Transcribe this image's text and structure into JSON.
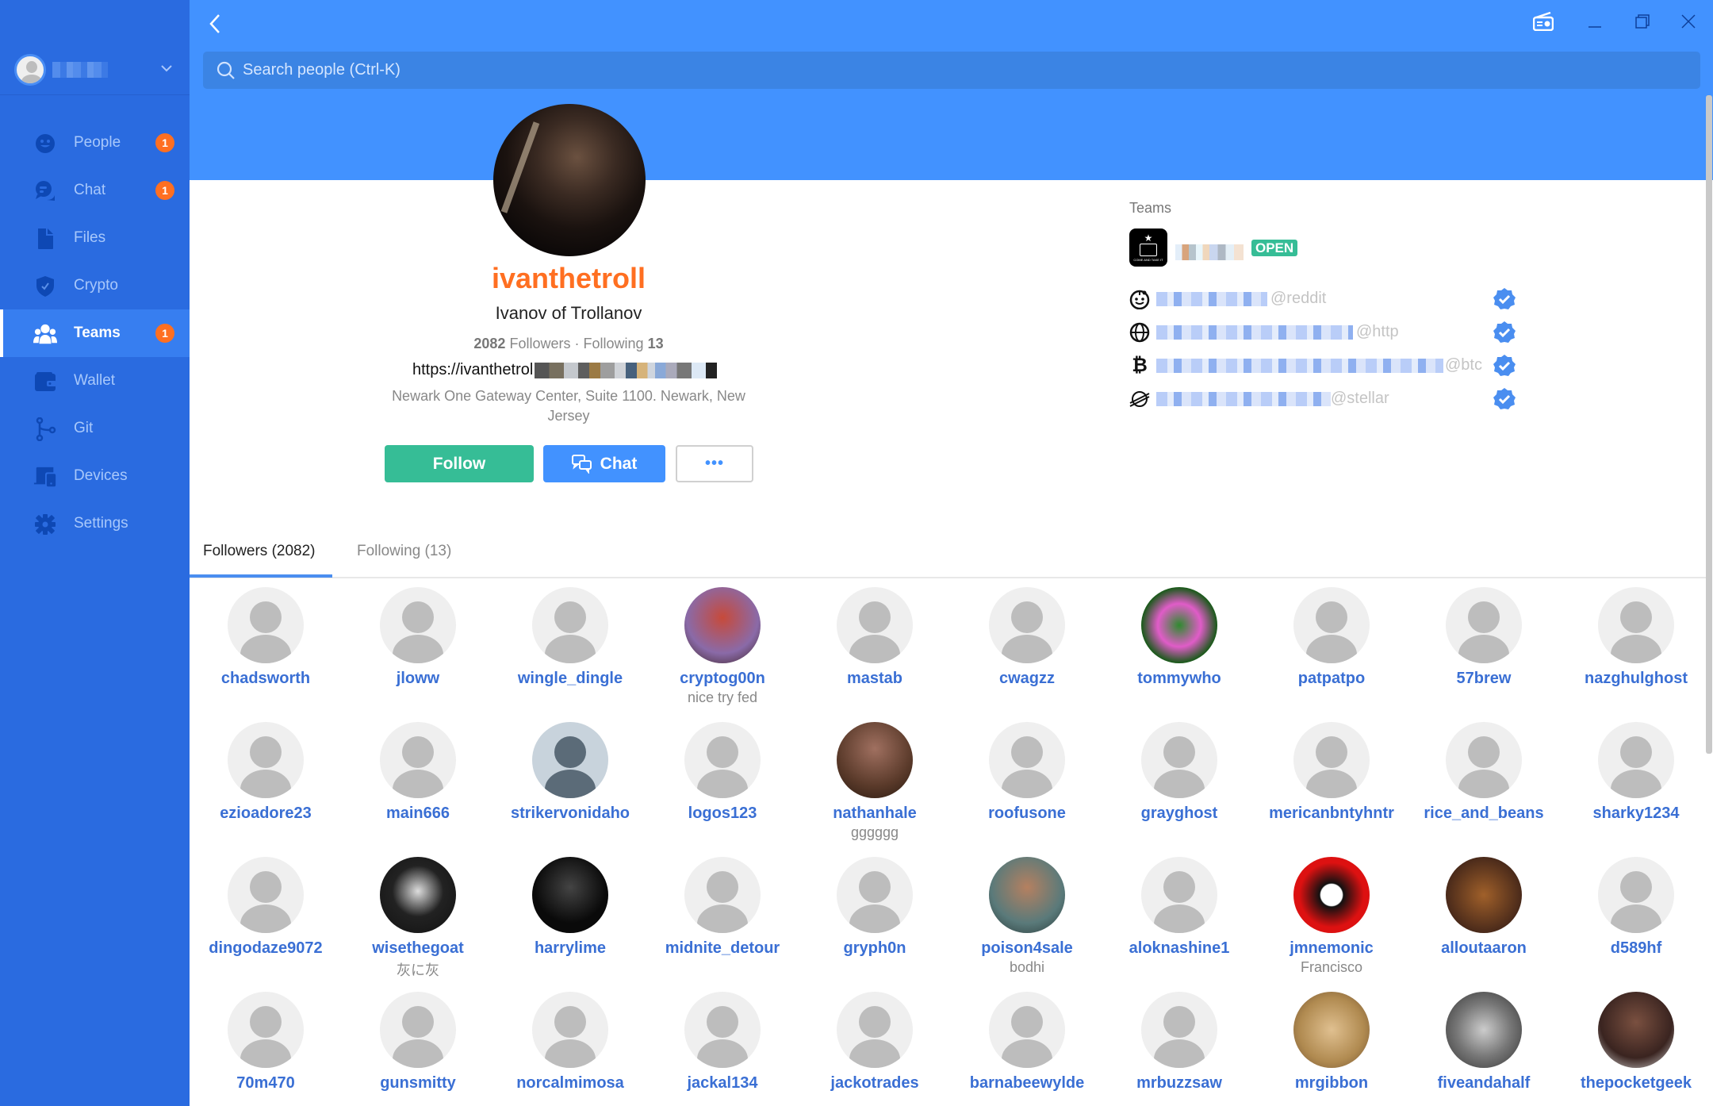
{
  "sidebar": {
    "account": {
      "username_redacted": true
    },
    "items": [
      {
        "label": "People",
        "icon": "smile-icon",
        "badge": "1",
        "active": false
      },
      {
        "label": "Chat",
        "icon": "chat-bubbles-icon",
        "badge": "1",
        "active": false
      },
      {
        "label": "Files",
        "icon": "file-icon",
        "badge": null,
        "active": false
      },
      {
        "label": "Crypto",
        "icon": "shield-check-icon",
        "badge": null,
        "active": false
      },
      {
        "label": "Teams",
        "icon": "people-group-icon",
        "badge": "1",
        "active": true
      },
      {
        "label": "Wallet",
        "icon": "wallet-icon",
        "badge": null,
        "active": false
      },
      {
        "label": "Git",
        "icon": "git-branch-icon",
        "badge": null,
        "active": false
      },
      {
        "label": "Devices",
        "icon": "devices-icon",
        "badge": null,
        "active": false
      },
      {
        "label": "Settings",
        "icon": "gear-icon",
        "badge": null,
        "active": false
      }
    ]
  },
  "header": {
    "search_placeholder": "Search people (Ctrl-K)",
    "window_controls": [
      "radio-icon",
      "minimize-icon",
      "restore-icon",
      "close-icon"
    ]
  },
  "profile": {
    "username": "ivanthetroll",
    "full_name": "Ivanov of Trollanov",
    "followers_count": "2082",
    "followers_label": "Followers",
    "separator": "·",
    "following_label": "Following",
    "following_count": "13",
    "url_prefix": "https://ivanthetrol",
    "location": "Newark One Gateway Center, Suite 1100. Newark, New Jersey",
    "buttons": {
      "follow": "Follow",
      "chat": "Chat",
      "more": "•••"
    }
  },
  "teams_panel": {
    "title": "Teams",
    "team": {
      "logo_text": "COME AND TAKE IT",
      "status_badge": "OPEN"
    },
    "proofs": [
      {
        "icon": "reddit-icon",
        "service": "@reddit",
        "verified": true
      },
      {
        "icon": "globe-icon",
        "service": "@http",
        "verified": true
      },
      {
        "icon": "bitcoin-icon",
        "service": "@btc",
        "verified": true
      },
      {
        "icon": "stellar-icon",
        "service": "@stellar",
        "verified": true
      }
    ]
  },
  "tabs": [
    {
      "label": "Followers (2082)",
      "active": true
    },
    {
      "label": "Following (13)",
      "active": false
    }
  ],
  "followers": [
    {
      "name": "chadsworth",
      "sub": "",
      "avatar": "default"
    },
    {
      "name": "jloww",
      "sub": "",
      "avatar": "default"
    },
    {
      "name": "wingle_dingle",
      "sub": "",
      "avatar": "default"
    },
    {
      "name": "cryptog00n",
      "sub": "nice try fed",
      "avatar": "photo"
    },
    {
      "name": "mastab",
      "sub": "",
      "avatar": "default"
    },
    {
      "name": "cwagzz",
      "sub": "",
      "avatar": "default"
    },
    {
      "name": "tommywho",
      "sub": "",
      "avatar": "photo"
    },
    {
      "name": "patpatpo",
      "sub": "",
      "avatar": "default"
    },
    {
      "name": "57brew",
      "sub": "",
      "avatar": "default"
    },
    {
      "name": "nazghulghost",
      "sub": "",
      "avatar": "default"
    },
    {
      "name": "ezioadore23",
      "sub": "",
      "avatar": "default"
    },
    {
      "name": "main666",
      "sub": "",
      "avatar": "default"
    },
    {
      "name": "strikervonidaho",
      "sub": "",
      "avatar": "dark-default"
    },
    {
      "name": "logos123",
      "sub": "",
      "avatar": "default"
    },
    {
      "name": "nathanhale",
      "sub": "gggggg",
      "avatar": "photo"
    },
    {
      "name": "roofusone",
      "sub": "",
      "avatar": "default"
    },
    {
      "name": "grayghost",
      "sub": "",
      "avatar": "default"
    },
    {
      "name": "mericanbntyhntr",
      "sub": "",
      "avatar": "default"
    },
    {
      "name": "rice_and_beans",
      "sub": "",
      "avatar": "default"
    },
    {
      "name": "sharky1234",
      "sub": "",
      "avatar": "default"
    },
    {
      "name": "dingodaze9072",
      "sub": "",
      "avatar": "default"
    },
    {
      "name": "wisethegoat",
      "sub": "灰に灰",
      "avatar": "photo"
    },
    {
      "name": "harrylime",
      "sub": "",
      "avatar": "photo"
    },
    {
      "name": "midnite_detour",
      "sub": "",
      "avatar": "default"
    },
    {
      "name": "gryph0n",
      "sub": "",
      "avatar": "default"
    },
    {
      "name": "poison4sale",
      "sub": "bodhi",
      "avatar": "photo"
    },
    {
      "name": "aloknashine1",
      "sub": "",
      "avatar": "default"
    },
    {
      "name": "jmnemonic",
      "sub": "Francisco",
      "avatar": "photo"
    },
    {
      "name": "alloutaaron",
      "sub": "",
      "avatar": "photo"
    },
    {
      "name": "d589hf",
      "sub": "",
      "avatar": "default"
    },
    {
      "name": "70m470",
      "sub": "",
      "avatar": "default"
    },
    {
      "name": "gunsmitty",
      "sub": "",
      "avatar": "default"
    },
    {
      "name": "norcalmimosa",
      "sub": "",
      "avatar": "default"
    },
    {
      "name": "jackal134",
      "sub": "",
      "avatar": "default"
    },
    {
      "name": "jackotrades",
      "sub": "",
      "avatar": "default"
    },
    {
      "name": "barnabeewylde",
      "sub": "",
      "avatar": "default"
    },
    {
      "name": "mrbuzzsaw",
      "sub": "",
      "avatar": "default"
    },
    {
      "name": "mrgibbon",
      "sub": "",
      "avatar": "photo"
    },
    {
      "name": "fiveandahalf",
      "sub": "",
      "avatar": "photo"
    },
    {
      "name": "thepocketgeek",
      "sub": "",
      "avatar": "photo"
    }
  ],
  "colors": {
    "sidebar_bg": "#2a6be0",
    "header_bg": "#4292ff",
    "username": "#ff6f21",
    "follow_button": "#36bd96",
    "link": "#3a6fd4",
    "badge": "#ff6f21"
  }
}
